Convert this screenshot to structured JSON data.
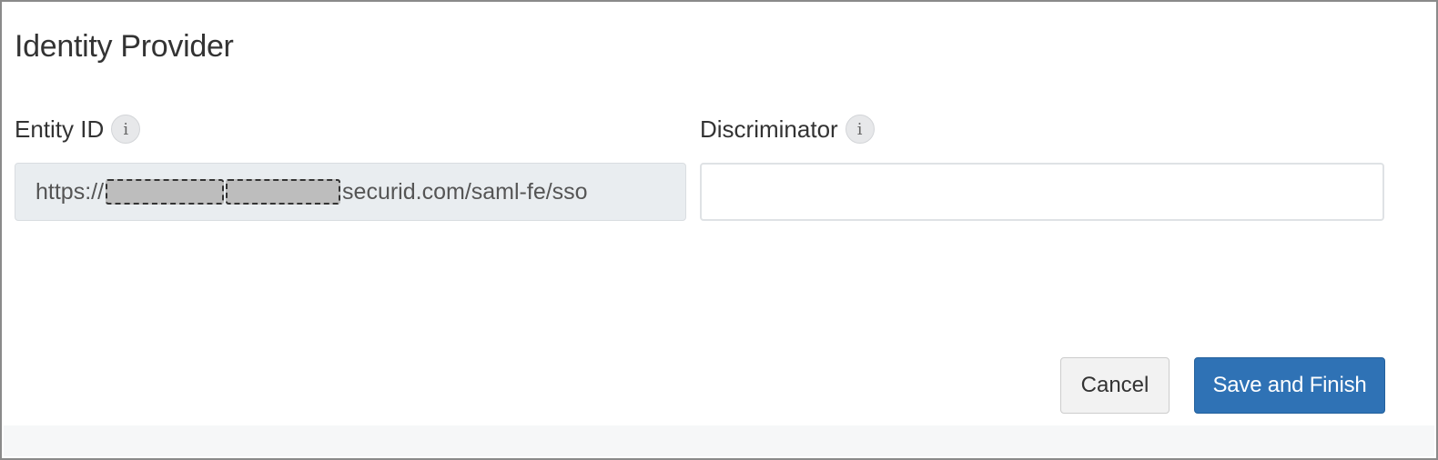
{
  "header": {
    "title": "Identity Provider"
  },
  "fields": {
    "entity_id": {
      "label": "Entity ID",
      "info_icon": "info-icon",
      "value_prefix": "https://",
      "value_suffix": "securid.com/saml-fe/sso",
      "read_only": true
    },
    "discriminator": {
      "label": "Discriminator",
      "info_icon": "info-icon",
      "value": ""
    }
  },
  "actions": {
    "cancel_label": "Cancel",
    "save_label": "Save and Finish"
  },
  "colors": {
    "primary": "#2f72b5",
    "readonly_bg": "#e9edf0"
  }
}
